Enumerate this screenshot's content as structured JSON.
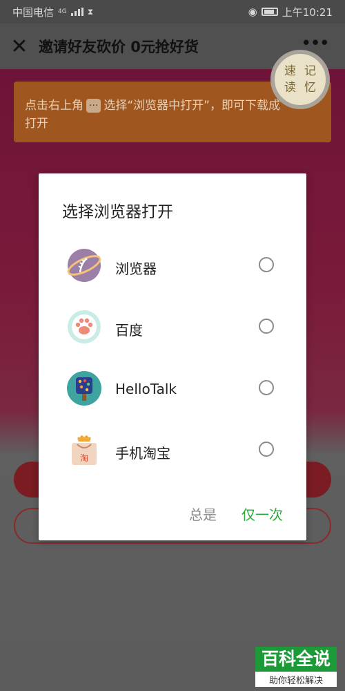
{
  "status_bar": {
    "carrier": "中国电信",
    "network": "4G",
    "time": "上午10:21"
  },
  "title_bar": {
    "close_glyph": "✕",
    "title": "邀请好友砍价 0元抢好货",
    "more_glyph": "•••"
  },
  "badge": {
    "chars": [
      "速",
      "记",
      "读",
      "忆"
    ]
  },
  "hint": {
    "text_before": "点击右上角",
    "dots": "···",
    "text_after": "选择“浏览器中打开”，即可下载成",
    "line2": "打开"
  },
  "dialog": {
    "title": "选择浏览器打开",
    "options": [
      {
        "label": "浏览器",
        "icon": "planet-browser-icon"
      },
      {
        "label": "百度",
        "icon": "baidu-paw-icon"
      },
      {
        "label": "HelloTalk",
        "icon": "hellotalk-tree-icon"
      },
      {
        "label": "手机淘宝",
        "icon": "taobao-bag-icon"
      }
    ],
    "always_label": "总是",
    "once_label": "仅一次"
  },
  "watermark": {
    "title": "百科全说",
    "subtitle": "助你轻松解决"
  },
  "colors": {
    "accent_green": "#2aaa3a",
    "watermark_green": "#1b9a37"
  }
}
